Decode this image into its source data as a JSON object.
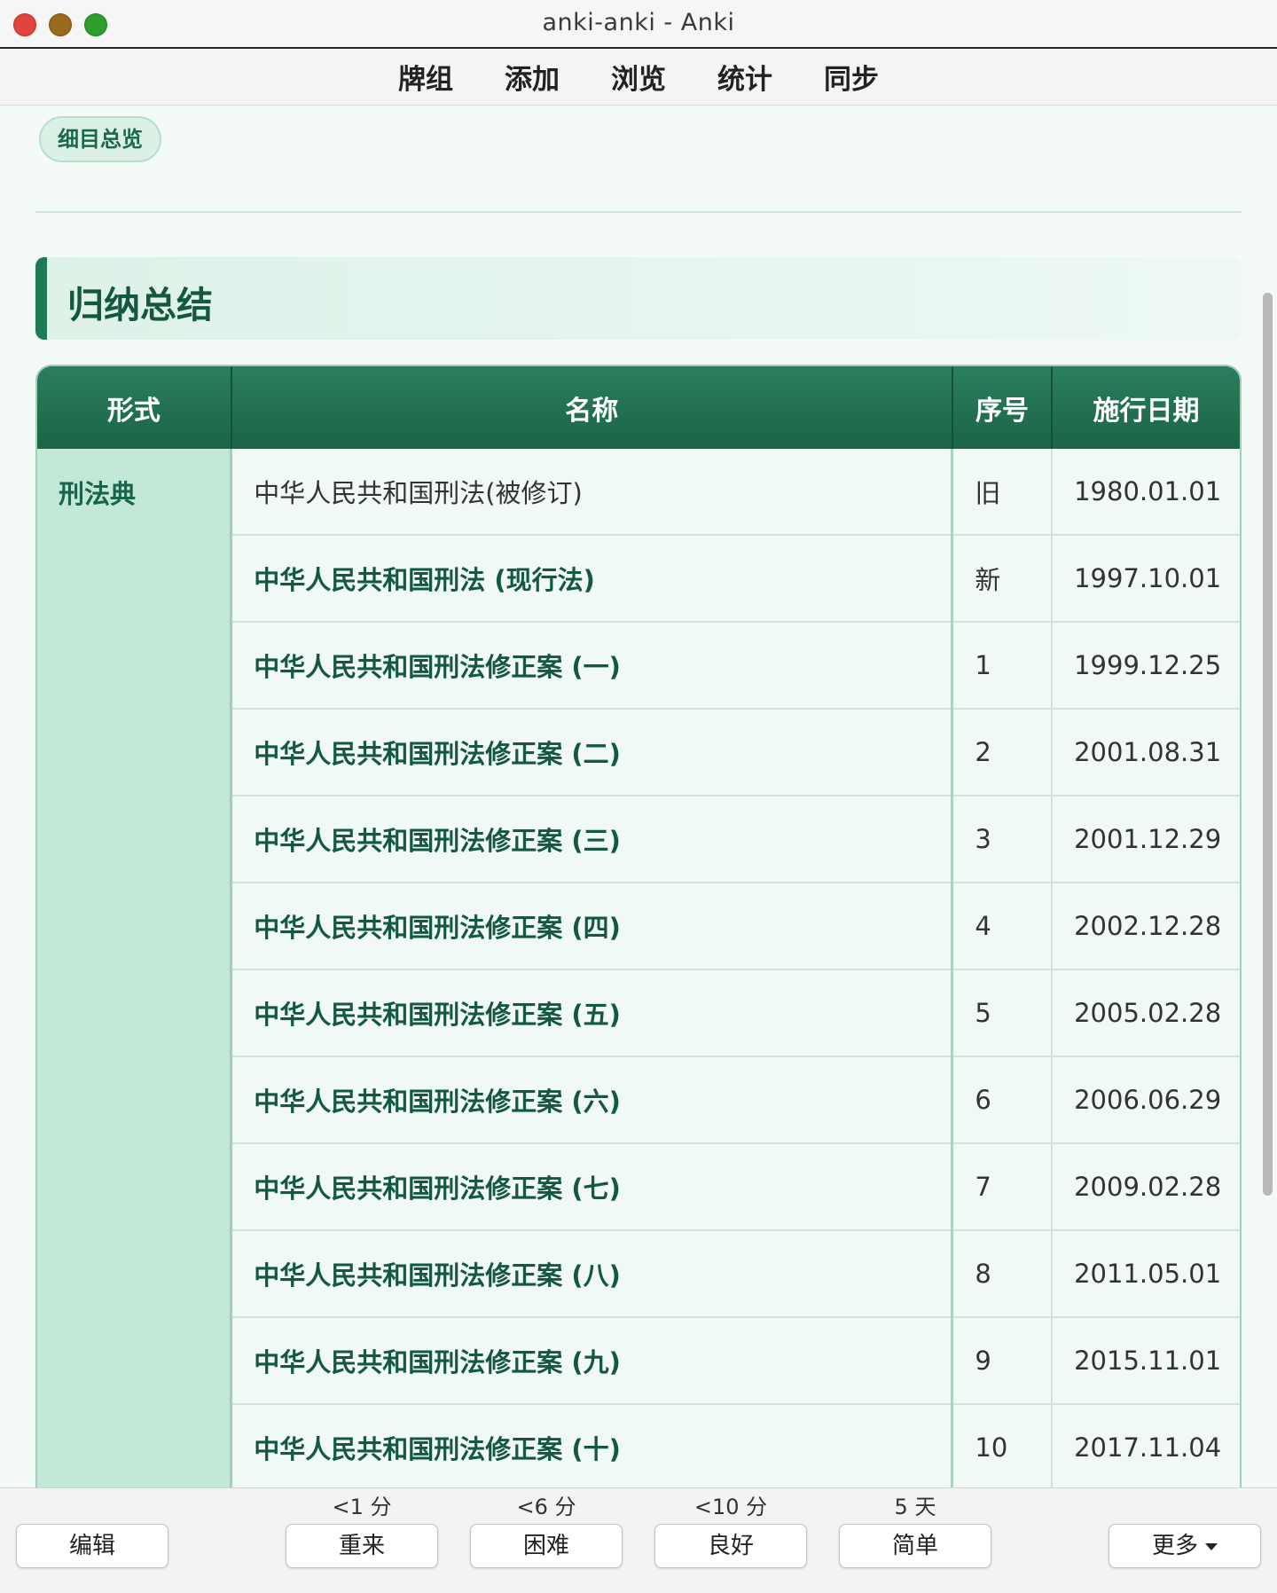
{
  "window": {
    "title": "anki-anki - Anki"
  },
  "toolbar": {
    "items": [
      "牌组",
      "添加",
      "浏览",
      "统计",
      "同步"
    ]
  },
  "card": {
    "pill_label": "细目总览",
    "section_title": "归纳总结",
    "table": {
      "headers": [
        "形式",
        "名称",
        "序号",
        "施行日期"
      ],
      "form_label": "刑法典",
      "rows": [
        {
          "name": "中华人民共和国刑法(被修订)",
          "seq": "旧",
          "date": "1980.01.01"
        },
        {
          "name": "中华人民共和国刑法 (现行法)",
          "seq": "新",
          "date": "1997.10.01"
        },
        {
          "name": "中华人民共和国刑法修正案 (一)",
          "seq": "1",
          "date": "1999.12.25"
        },
        {
          "name": "中华人民共和国刑法修正案 (二)",
          "seq": "2",
          "date": "2001.08.31"
        },
        {
          "name": "中华人民共和国刑法修正案 (三)",
          "seq": "3",
          "date": "2001.12.29"
        },
        {
          "name": "中华人民共和国刑法修正案 (四)",
          "seq": "4",
          "date": "2002.12.28"
        },
        {
          "name": "中华人民共和国刑法修正案 (五)",
          "seq": "5",
          "date": "2005.02.28"
        },
        {
          "name": "中华人民共和国刑法修正案 (六)",
          "seq": "6",
          "date": "2006.06.29"
        },
        {
          "name": "中华人民共和国刑法修正案 (七)",
          "seq": "7",
          "date": "2009.02.28"
        },
        {
          "name": "中华人民共和国刑法修正案 (八)",
          "seq": "8",
          "date": "2011.05.01"
        },
        {
          "name": "中华人民共和国刑法修正案 (九)",
          "seq": "9",
          "date": "2015.11.01"
        },
        {
          "name": "中华人民共和国刑法修正案 (十)",
          "seq": "10",
          "date": "2017.11.04"
        }
      ]
    }
  },
  "reviewer": {
    "edit_label": "编辑",
    "more_label": "更多",
    "answers": [
      {
        "label": "重来",
        "interval": "<1 分"
      },
      {
        "label": "困难",
        "interval": "<6 分"
      },
      {
        "label": "良好",
        "interval": "<10 分"
      },
      {
        "label": "简单",
        "interval": "5 天"
      }
    ]
  }
}
